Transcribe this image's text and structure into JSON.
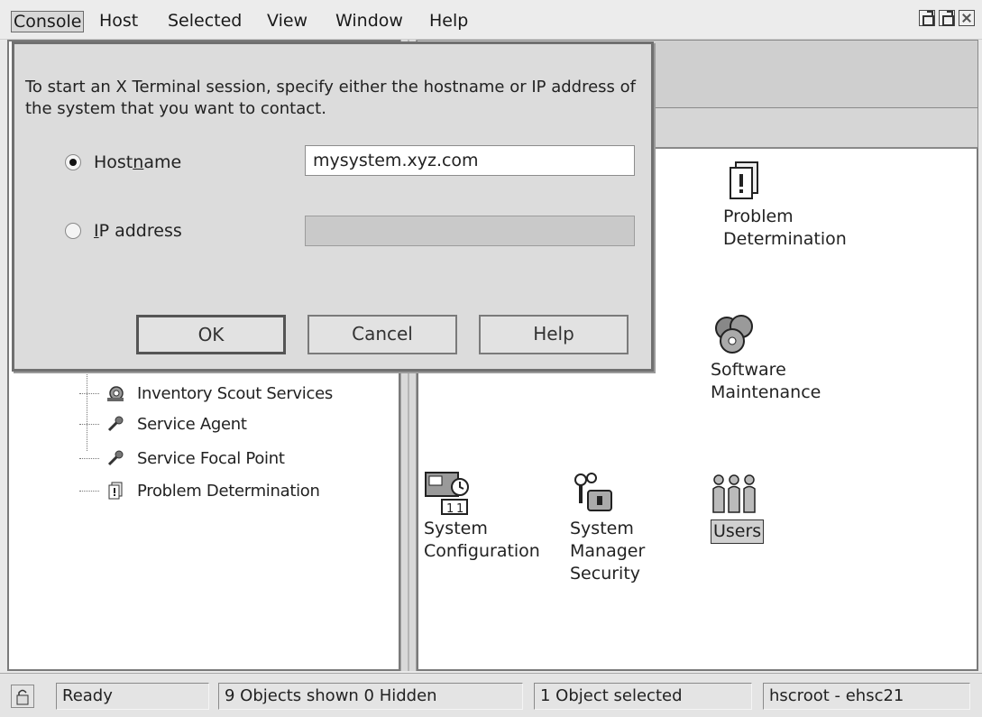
{
  "menubar": {
    "items": [
      "Console",
      "Host",
      "Selected",
      "View",
      "Window",
      "Help"
    ],
    "active": "Console",
    "window_controls": [
      "restore-icon",
      "maximize-icon",
      "close-icon"
    ]
  },
  "tree": {
    "items": [
      {
        "label": "Inventory Scout Services",
        "icon": "inventory-scout-icon"
      },
      {
        "label": "Service Agent",
        "icon": "wrench-icon"
      },
      {
        "label": "Service Focal Point",
        "icon": "wrench-icon"
      },
      {
        "label": "Problem Determination",
        "icon": "problem-determination-icon"
      }
    ]
  },
  "workplace": {
    "tasks": [
      {
        "label": "Problem\nDetermination",
        "icon": "problem-determination-icon"
      },
      {
        "label": "Software\nMaintenance",
        "icon": "software-maintenance-icon"
      },
      {
        "label": "System\nConfiguration",
        "icon": "system-configuration-icon"
      },
      {
        "label": "System\nManager\nSecurity",
        "icon": "security-keys-icon"
      },
      {
        "label": "Users",
        "icon": "users-icon",
        "selected": true
      }
    ]
  },
  "dialog": {
    "message": "To start an X Terminal session, specify either the hostname or IP address of the system that you want to contact.",
    "hostname": {
      "label_pre": "Host",
      "label_mnemonic": "n",
      "label_post": "ame",
      "value": "mysystem.xyz.com",
      "selected": true
    },
    "ip": {
      "label_mnemonic": "I",
      "label_post": "P address",
      "value": "",
      "selected": false
    },
    "buttons": {
      "ok": "OK",
      "cancel": "Cancel",
      "help": "Help"
    }
  },
  "statusbar": {
    "status": "Ready",
    "objects": "9 Objects shown 0 Hidden",
    "selected": "1 Object selected",
    "user": "hscroot - ehsc21"
  }
}
